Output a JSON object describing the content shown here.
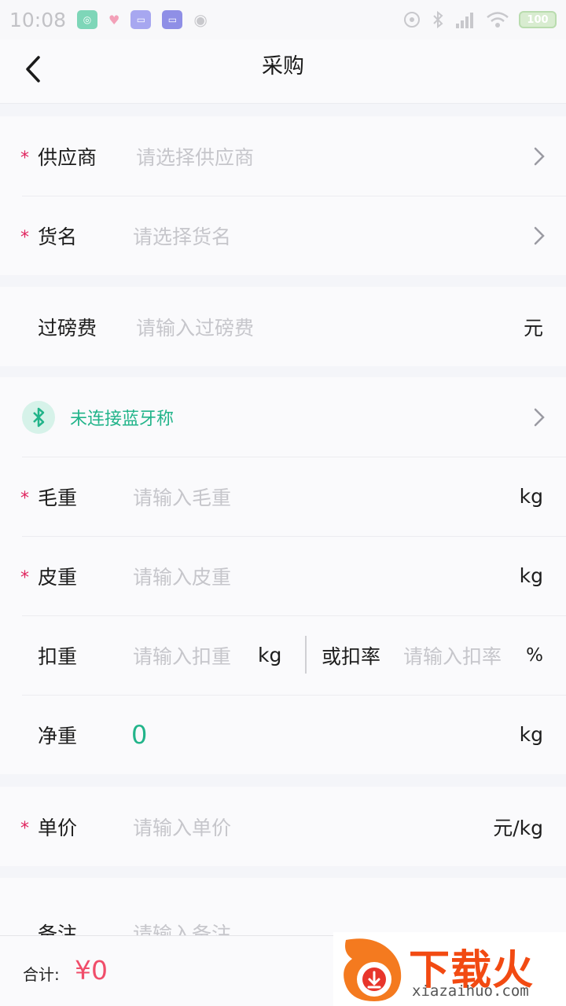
{
  "status": {
    "time": "10:08",
    "battery": "100",
    "colors": {
      "app1": "#7ed6b8",
      "app2": "#a7a7f0",
      "app3": "#8f8fe6"
    }
  },
  "nav": {
    "title": "采购"
  },
  "supplier": {
    "label": "供应商",
    "placeholder": "请选择供应商"
  },
  "goods": {
    "label": "货名",
    "placeholder": "请选择货名"
  },
  "weigh_fee": {
    "label": "过磅费",
    "placeholder": "请输入过磅费",
    "unit": "元"
  },
  "bluetooth": {
    "status": "未连接蓝牙称"
  },
  "gross": {
    "label": "毛重",
    "placeholder": "请输入毛重",
    "unit": "kg"
  },
  "tare": {
    "label": "皮重",
    "placeholder": "请输入皮重",
    "unit": "kg"
  },
  "deduct": {
    "label": "扣重",
    "placeholder": "请输入扣重",
    "unit": "kg",
    "rate_label": "或扣率",
    "rate_placeholder": "请输入扣率",
    "rate_unit": "%"
  },
  "net": {
    "label": "净重",
    "value": "0",
    "unit": "kg"
  },
  "price": {
    "label": "单价",
    "placeholder": "请输入单价",
    "unit": "元/kg"
  },
  "remark": {
    "label": "备注",
    "placeholder": "请输入备注"
  },
  "footer": {
    "total_label": "合计:",
    "total_value": "¥0"
  },
  "watermark": {
    "brand": "下载火",
    "url": "xiazaihuo.com"
  },
  "accent_color": "#22b48a",
  "required_color": "#e0245e"
}
